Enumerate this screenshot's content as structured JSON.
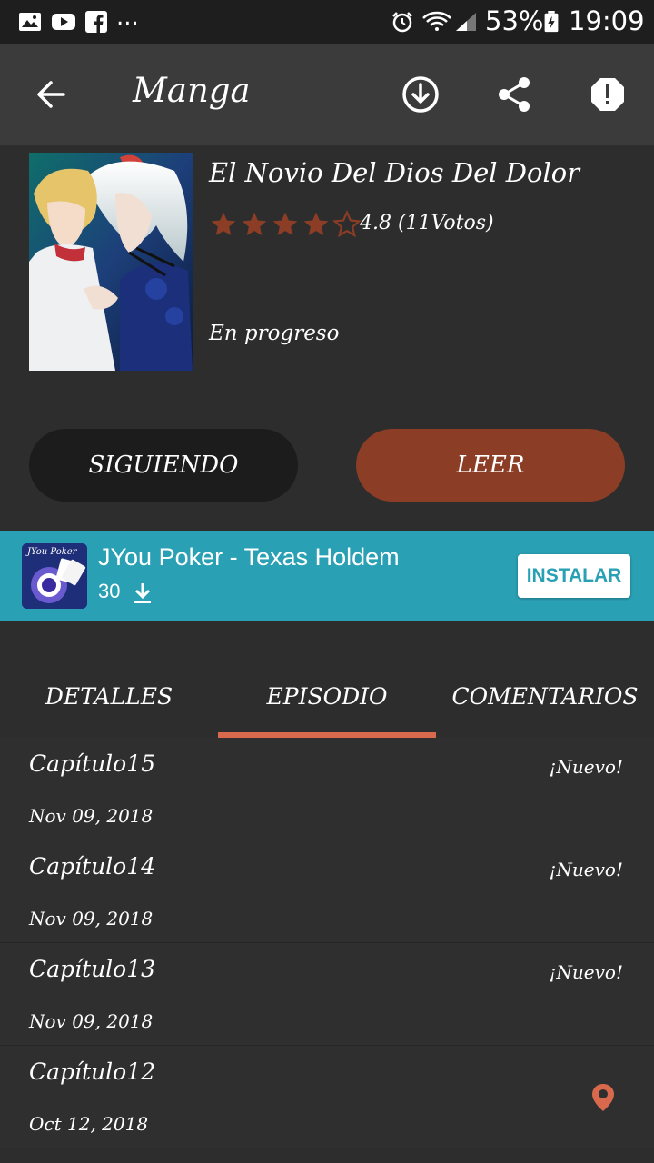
{
  "status_bar": {
    "left_more": "...",
    "battery": "53%",
    "time": "19:09"
  },
  "app_bar": {
    "title": "Manga",
    "icons": [
      "back-arrow-icon",
      "download-icon",
      "share-icon",
      "report-icon"
    ]
  },
  "manga": {
    "title": "El Novio Del Dios Del Dolor",
    "rating": 4.8,
    "rating_text": "4.8 (11Votos)",
    "stars_filled": 4,
    "stars_total": 5,
    "status": "En progreso"
  },
  "buttons": {
    "follow": "SIGUIENDO",
    "read": "LEER"
  },
  "ad": {
    "icon_label": "JYou Poker",
    "title": "JYou Poker - Texas Holdem",
    "count": "30",
    "install": "INSTALAR"
  },
  "tabs": [
    {
      "label": "DETALLES"
    },
    {
      "label": "EPISODIO",
      "active": true
    },
    {
      "label": "COMENTARIOS"
    }
  ],
  "chapters": [
    {
      "name": "Capítulo15",
      "date": "Nov 09, 2018",
      "badge": "¡Nuevo!"
    },
    {
      "name": "Capítulo14",
      "date": "Nov 09, 2018",
      "badge": "¡Nuevo!"
    },
    {
      "name": "Capítulo13",
      "date": "Nov 09, 2018",
      "badge": "¡Nuevo!"
    },
    {
      "name": "Capítulo12",
      "date": "Oct 12, 2018",
      "badge": ""
    }
  ],
  "colors": {
    "accent": "#8b3d26",
    "tab_indicator": "#d9694c",
    "star": "#8b3d26",
    "ad_bg": "#2aa0b4"
  }
}
